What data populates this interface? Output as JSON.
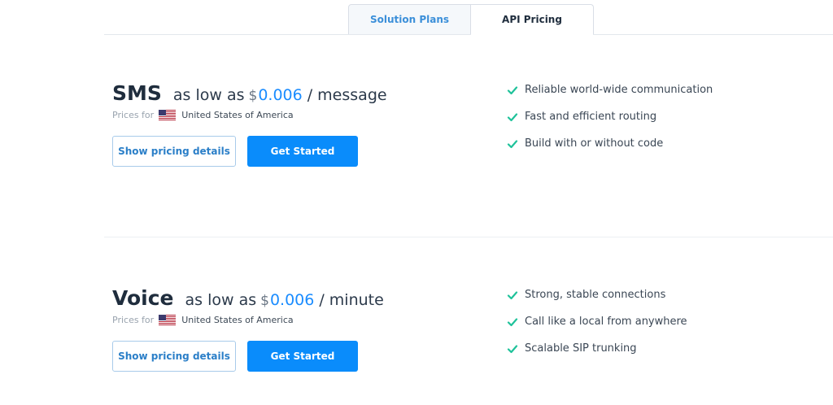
{
  "tabs": [
    {
      "label": "Solution Plans",
      "active": false
    },
    {
      "label": "API Pricing",
      "active": true
    }
  ],
  "products": [
    {
      "name": "SMS",
      "as_low_as": "as low as",
      "currency": "$",
      "price": "0.006",
      "unit": "/ message",
      "prices_for_label": "Prices for",
      "country": "United States of America",
      "flag": "us-flag-icon",
      "details_label": "Show pricing details",
      "cta_label": "Get Started",
      "features": [
        "Reliable world-wide communication",
        "Fast and efficient routing",
        "Build with or without code"
      ]
    },
    {
      "name": "Voice",
      "as_low_as": "as low as",
      "currency": "$",
      "price": "0.006",
      "unit": "/ minute",
      "prices_for_label": "Prices for",
      "country": "United States of America",
      "flag": "us-flag-icon",
      "details_label": "Show pricing details",
      "cta_label": "Get Started",
      "features": [
        "Strong, stable connections",
        "Call like a local from anywhere",
        "Scalable SIP trunking"
      ]
    }
  ],
  "colors": {
    "accent": "#0a8cfb",
    "price_text": "#1a8cff",
    "check": "#1fc29a",
    "heading": "#1f2d3d"
  }
}
